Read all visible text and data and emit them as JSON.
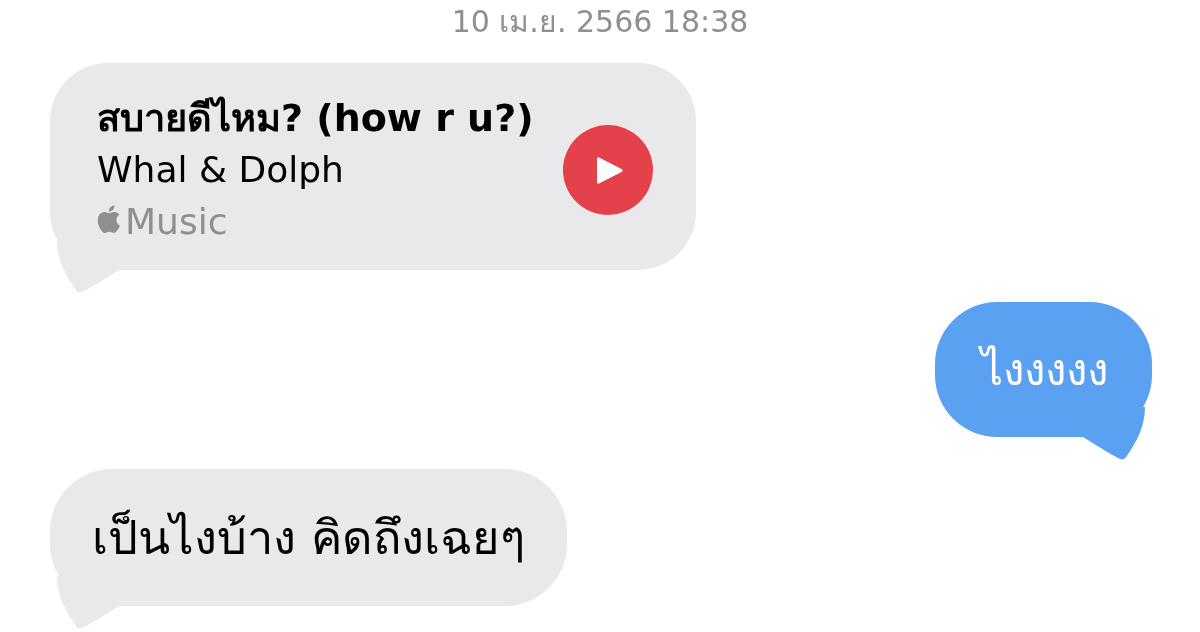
{
  "timestamp": "10 เม.ย. 2566 18:38",
  "messages": [
    {
      "kind": "music",
      "outgoing": false,
      "title": "สบายดีไหม? (how r u?)",
      "artist": "Whal & Dolph",
      "service": "Music"
    },
    {
      "kind": "text",
      "outgoing": true,
      "text": "ไงงงงง"
    },
    {
      "kind": "text",
      "outgoing": false,
      "text": "เป็นไงบ้าง คิดถึงเฉยๆ"
    }
  ]
}
